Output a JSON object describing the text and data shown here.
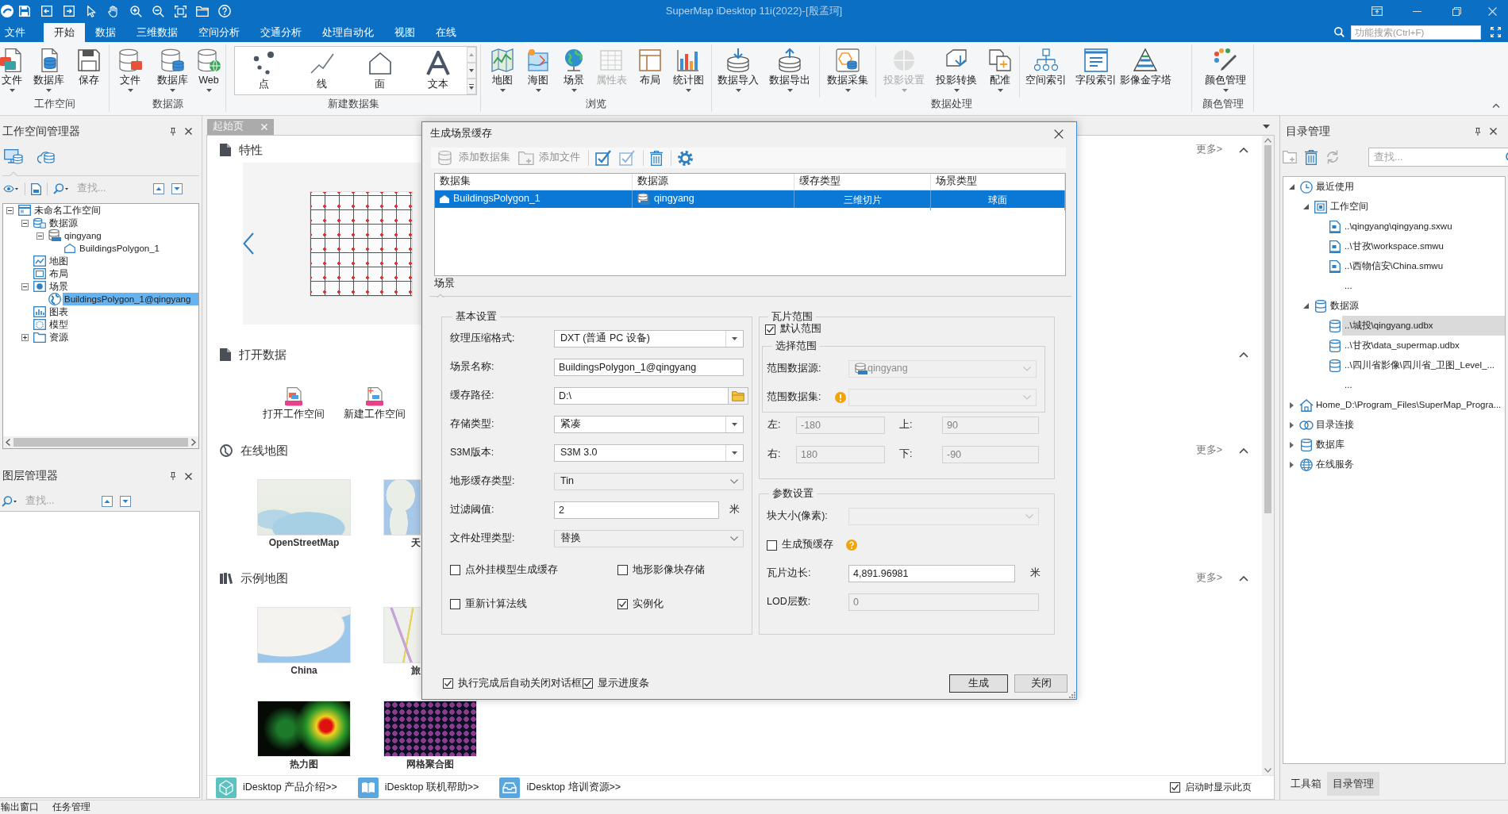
{
  "title_bar": {
    "title": "SuperMap iDesktop 11i(2022)-[殷孟珂]"
  },
  "menu_tabs": [
    {
      "label": "文件",
      "selected": false
    },
    {
      "label": "开始",
      "selected": true
    },
    {
      "label": "数据",
      "selected": false
    },
    {
      "label": "三维数据",
      "selected": false
    },
    {
      "label": "空间分析",
      "selected": false
    },
    {
      "label": "交通分析",
      "selected": false
    },
    {
      "label": "处理自动化",
      "selected": false
    },
    {
      "label": "视图",
      "selected": false
    },
    {
      "label": "在线",
      "selected": false
    }
  ],
  "function_search": {
    "placeholder": "功能搜索(Ctrl+F)"
  },
  "ribbon": [
    {
      "kind": "buttons",
      "label": "工作空间",
      "buttons": [
        {
          "label": "文件",
          "dropdown": true,
          "disabled": false
        },
        {
          "label": "数据库",
          "dropdown": true,
          "disabled": false
        },
        {
          "label": "保存",
          "dropdown": false,
          "disabled": false
        }
      ]
    },
    {
      "kind": "buttons",
      "label": "数据源",
      "buttons": [
        {
          "label": "文件",
          "dropdown": true,
          "disabled": false
        },
        {
          "label": "数据库",
          "dropdown": true,
          "disabled": false
        },
        {
          "label": "Web",
          "dropdown": true,
          "disabled": false
        }
      ]
    },
    {
      "kind": "gallery",
      "label": "新建数据集",
      "items": [
        "点",
        "线",
        "面",
        "文本"
      ]
    },
    {
      "kind": "buttons",
      "label": "浏览",
      "buttons": [
        {
          "label": "地图",
          "dropdown": true,
          "disabled": false
        },
        {
          "label": "海图",
          "dropdown": true,
          "disabled": false
        },
        {
          "label": "场景",
          "dropdown": true,
          "disabled": false
        },
        {
          "label": "属性表",
          "dropdown": false,
          "disabled": true
        },
        {
          "label": "布局",
          "dropdown": false,
          "disabled": false
        },
        {
          "label": "统计图",
          "dropdown": true,
          "disabled": false
        }
      ]
    },
    {
      "kind": "buttons",
      "label": "数据处理",
      "buttons": [
        {
          "label": "数据导入",
          "dropdown": true,
          "disabled": false
        },
        {
          "label": "数据导出",
          "dropdown": true,
          "disabled": false
        },
        {
          "label": "数据采集",
          "dropdown": true,
          "disabled": false
        },
        {
          "label": "投影设置",
          "dropdown": true,
          "disabled": true
        },
        {
          "label": "投影转换",
          "dropdown": true,
          "disabled": false
        },
        {
          "label": "配准",
          "dropdown": true,
          "disabled": false
        },
        {
          "label": "空间索引",
          "dropdown": false,
          "disabled": false
        },
        {
          "label": "字段索引",
          "dropdown": false,
          "disabled": false
        },
        {
          "label": "影像金字塔",
          "dropdown": false,
          "disabled": false
        }
      ]
    },
    {
      "kind": "buttons",
      "label": "颜色管理",
      "buttons": [
        {
          "label": "颜色管理",
          "dropdown": true,
          "disabled": false
        }
      ]
    }
  ],
  "workspace_manager": {
    "title": "工作空间管理器",
    "panel_tabs": [
      {
        "selected": true
      },
      {
        "selected": false
      }
    ],
    "search": {
      "placeholder": "查找..."
    },
    "tree": [
      {
        "kind": "workspace",
        "label": "未命名工作空间",
        "expanded": true,
        "selected": false,
        "children": [
          {
            "kind": "datasources",
            "label": "数据源",
            "expanded": true,
            "selected": false,
            "children": [
              {
                "kind": "datasource",
                "label": "qingyang",
                "expanded": true,
                "selected": false,
                "children": [
                  {
                    "kind": "region-dataset",
                    "label": "BuildingsPolygon_1",
                    "selected": false
                  }
                ]
              }
            ]
          },
          {
            "kind": "maps",
            "label": "地图",
            "selected": false
          },
          {
            "kind": "layouts",
            "label": "布局",
            "selected": false
          },
          {
            "kind": "scenes",
            "label": "场景",
            "expanded": true,
            "selected": false,
            "children": [
              {
                "kind": "scene",
                "label": "BuildingsPolygon_1@qingyang",
                "selected": true
              }
            ]
          },
          {
            "kind": "charts",
            "label": "图表",
            "selected": false
          },
          {
            "kind": "models",
            "label": "模型",
            "selected": false
          },
          {
            "kind": "resources",
            "label": "资源",
            "expanded": false,
            "selected": false
          }
        ]
      }
    ]
  },
  "layer_manager": {
    "title": "图层管理器",
    "search": {
      "placeholder": "查找..."
    }
  },
  "document_tab": {
    "label": "起始页"
  },
  "start_page": {
    "sections": [
      {
        "kind": "carousel",
        "title": "特性",
        "more": "更多>",
        "expanded": true
      },
      {
        "kind": "actions",
        "title": "打开数据",
        "expanded": true,
        "items": [
          {
            "kind": "open",
            "label": "打开工作空间"
          },
          {
            "kind": "new",
            "label": "新建工作空间"
          }
        ]
      },
      {
        "kind": "thumbnails",
        "title": "在线地图",
        "more": "更多>",
        "expanded": true,
        "items": [
          {
            "kind": "street-map",
            "label": "OpenStreetMap",
            "clipped": false
          },
          {
            "kind": "world-map",
            "label": "天",
            "clipped": true
          }
        ]
      },
      {
        "kind": "thumbnails",
        "title": "示例地图",
        "more": "更多>",
        "expanded": true,
        "items": [
          {
            "kind": "china-map",
            "label": "China",
            "clipped": false
          },
          {
            "kind": "route-map",
            "label": "旅",
            "clipped": true
          },
          {
            "kind": "heat-map",
            "label": "热力图",
            "clipped": false
          },
          {
            "kind": "hex-map",
            "label": "网格聚合图",
            "clipped": false
          }
        ]
      }
    ],
    "links": [
      "iDesktop 产品介绍>>",
      "iDesktop 联机帮助>>",
      "iDesktop 培训资源>>"
    ],
    "show_on_startup": {
      "label": "启动时显示此页",
      "checked": true
    }
  },
  "dialog": {
    "title": "生成场景缓存",
    "toolbar": [
      {
        "label": "添加数据集",
        "disabled": true
      },
      {
        "label": "添加文件",
        "disabled": true
      }
    ],
    "table": {
      "columns": [
        "数据集",
        "数据源",
        "缓存类型",
        "场景类型"
      ],
      "rows": [
        {
          "selected": true,
          "cells": [
            "BuildingsPolygon_1",
            "qingyang",
            "三维切片",
            "球面"
          ]
        }
      ]
    },
    "tabs": [
      {
        "label": "场景",
        "selected": true
      }
    ],
    "basic_settings": {
      "title": "基本设置",
      "fields": [
        {
          "kind": "combo",
          "label": "纹理压缩格式:",
          "value": "DXT (普通 PC 设备)"
        },
        {
          "kind": "text",
          "label": "场景名称:",
          "value": "BuildingsPolygon_1@qingyang"
        },
        {
          "kind": "path",
          "label": "缓存路径:",
          "value": "D:\\"
        },
        {
          "kind": "combo",
          "label": "存储类型:",
          "value": "紧凑"
        },
        {
          "kind": "combo",
          "label": "S3M版本:",
          "value": "S3M 3.0"
        },
        {
          "kind": "list",
          "label": "地形缓存类型:",
          "value": "Tin"
        },
        {
          "kind": "text",
          "label": "过滤阈值:",
          "value": "2",
          "unit": "米"
        },
        {
          "kind": "list",
          "label": "文件处理类型:",
          "value": "替换"
        }
      ],
      "options": [
        {
          "label": "点外挂模型生成缓存",
          "checked": false
        },
        {
          "label": "地形影像块存储",
          "checked": false
        },
        {
          "label": "重新计算法线",
          "checked": false
        },
        {
          "label": "实例化",
          "checked": true
        }
      ]
    },
    "tile_extent": {
      "title": "瓦片范围",
      "default_extent": {
        "label": "默认范围",
        "checked": true
      },
      "select_extent": {
        "title": "选择范围",
        "fields": [
          {
            "label": "范围数据源:",
            "value": "qingyang",
            "disabled": true,
            "warning": false
          },
          {
            "label": "范围数据集:",
            "disabled": true,
            "warning": true
          }
        ]
      },
      "bounds": [
        {
          "label": "左:",
          "value": "-180",
          "disabled": true
        },
        {
          "label": "上:",
          "value": "90",
          "disabled": true
        },
        {
          "label": "右:",
          "value": "180",
          "disabled": true
        },
        {
          "label": "下:",
          "value": "-90",
          "disabled": true
        }
      ]
    },
    "parameters": {
      "title": "参数设置",
      "fields": [
        {
          "kind": "list",
          "label": "块大小(像素):",
          "disabled": true
        },
        {
          "kind": "checkbox",
          "label": "生成预缓存",
          "checked": false,
          "help": true
        },
        {
          "kind": "text",
          "label": "瓦片边长:",
          "value": "4,891.96981",
          "unit": "米",
          "disabled": false
        },
        {
          "kind": "text",
          "label": "LOD层数:",
          "value": "0",
          "disabled": true
        }
      ]
    },
    "footer_options": [
      {
        "label": "执行完成后自动关闭对话框",
        "checked": true
      },
      {
        "label": "显示进度条",
        "checked": true
      }
    ],
    "buttons": [
      {
        "label": "生成",
        "default": true
      },
      {
        "label": "关闭",
        "default": false
      }
    ]
  },
  "catalog": {
    "title": "目录管理",
    "search": {
      "placeholder": "查找..."
    },
    "tree": [
      {
        "kind": "recent",
        "label": "最近使用",
        "expanded": true,
        "selected": false,
        "children": [
          {
            "kind": "workspaces",
            "label": "工作空间",
            "expanded": true,
            "selected": false,
            "children": [
              {
                "kind": "workspace-file",
                "label": "..\\qingyang\\qingyang.sxwu",
                "selected": false
              },
              {
                "kind": "workspace-file",
                "label": "..\\甘孜\\workspace.smwu",
                "selected": false
              },
              {
                "kind": "workspace-file",
                "label": "..\\西物信安\\China.smwu",
                "selected": false
              },
              {
                "kind": "more",
                "label": "...",
                "selected": false
              }
            ]
          },
          {
            "kind": "datasources",
            "label": "数据源",
            "expanded": true,
            "selected": false,
            "children": [
              {
                "kind": "datasource-file",
                "label": "..\\城投\\qingyang.udbx",
                "selected": true
              },
              {
                "kind": "datasource-file",
                "label": "..\\甘孜\\data_supermap.udbx",
                "selected": false
              },
              {
                "kind": "datasource-file",
                "label": "..\\四川省影像\\四川省_卫图_Level_...",
                "selected": false
              },
              {
                "kind": "more",
                "label": "...",
                "selected": false
              }
            ]
          }
        ]
      },
      {
        "kind": "home",
        "label": "Home_D:\\Program_Files\\SuperMap_Progra...",
        "expanded": false,
        "selected": false
      },
      {
        "kind": "connection",
        "label": "目录连接",
        "expanded": false,
        "selected": false
      },
      {
        "kind": "database",
        "label": "数据库",
        "expanded": false,
        "selected": false
      },
      {
        "kind": "online",
        "label": "在线服务",
        "expanded": false,
        "selected": false
      }
    ],
    "side_tabs": [
      {
        "label": "工具箱",
        "selected": false
      },
      {
        "label": "目录管理",
        "selected": true
      }
    ]
  },
  "output_tabs": [
    "输出窗口",
    "任务管理"
  ]
}
